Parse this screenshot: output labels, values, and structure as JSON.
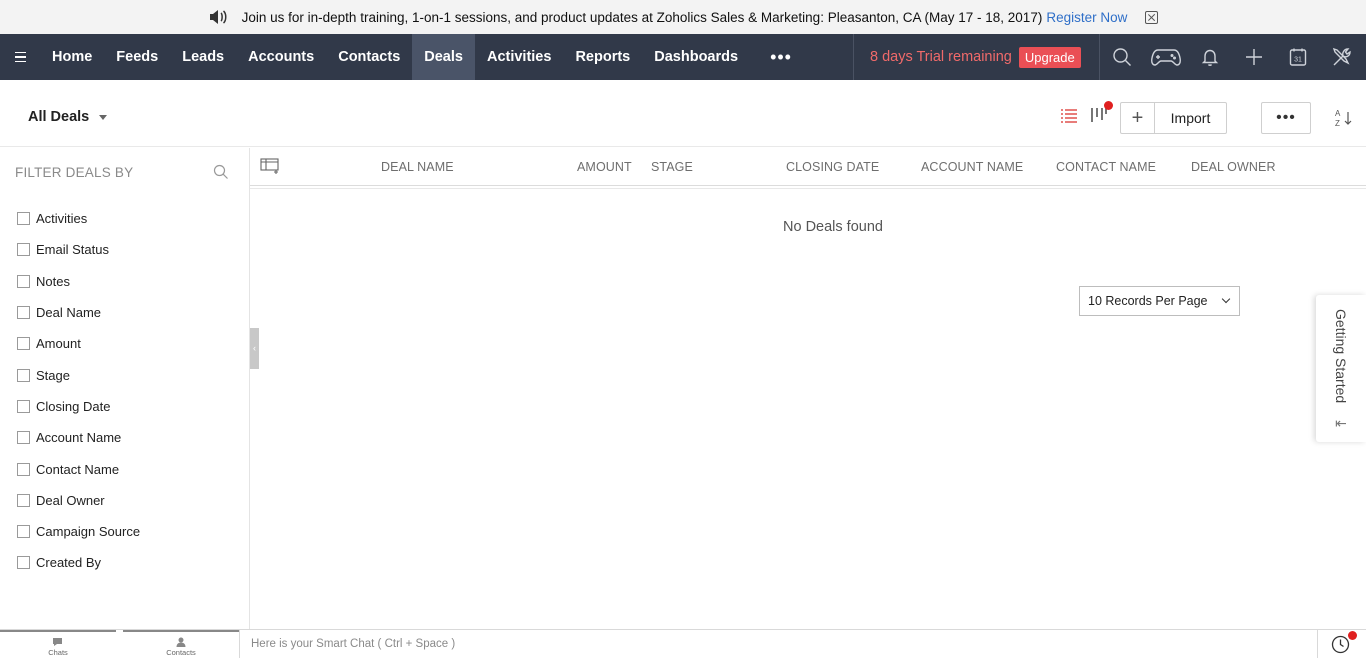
{
  "announcement": {
    "text": "Join us for in-depth training, 1-on-1 sessions, and product updates at Zoholics Sales & Marketing: Pleasanton, CA (May 17 - 18, 2017)",
    "link": "Register Now"
  },
  "nav": {
    "tabs": [
      {
        "label": "Home"
      },
      {
        "label": "Feeds"
      },
      {
        "label": "Leads"
      },
      {
        "label": "Accounts"
      },
      {
        "label": "Contacts"
      },
      {
        "label": "Deals"
      },
      {
        "label": "Activities"
      },
      {
        "label": "Reports"
      },
      {
        "label": "Dashboards"
      }
    ],
    "more": "•••",
    "trial_text": "8 days Trial remaining",
    "upgrade_label": "Upgrade",
    "icons": [
      "search-icon",
      "gamepad-icon",
      "bell-icon",
      "plus-icon",
      "calendar-icon",
      "tools-icon"
    ],
    "calendar_day": "31"
  },
  "toolbar": {
    "view_label": "All Deals",
    "plus": "+",
    "import_label": "Import",
    "more": "•••"
  },
  "sidebar": {
    "title": "FILTER DEALS BY",
    "filters": [
      "Activities",
      "Email Status",
      "Notes",
      "Deal Name",
      "Amount",
      "Stage",
      "Closing Date",
      "Account Name",
      "Contact Name",
      "Deal Owner",
      "Campaign Source",
      "Created By"
    ]
  },
  "table": {
    "columns": [
      "DEAL NAME",
      "AMOUNT",
      "STAGE",
      "CLOSING DATE",
      "ACCOUNT NAME",
      "CONTACT NAME",
      "DEAL OWNER"
    ],
    "empty_message": "No Deals found",
    "per_page": "10 Records Per Page"
  },
  "getting_started": "Getting Started",
  "bottom": {
    "chats": "Chats",
    "contacts": "Contacts",
    "smart_chat_placeholder": "Here is your Smart Chat ( Ctrl + Space )"
  },
  "colors": {
    "nav_bg": "#313949",
    "nav_active": "#4a5468",
    "accent_red": "#ea4f55",
    "link_blue": "#2f6fc8"
  }
}
